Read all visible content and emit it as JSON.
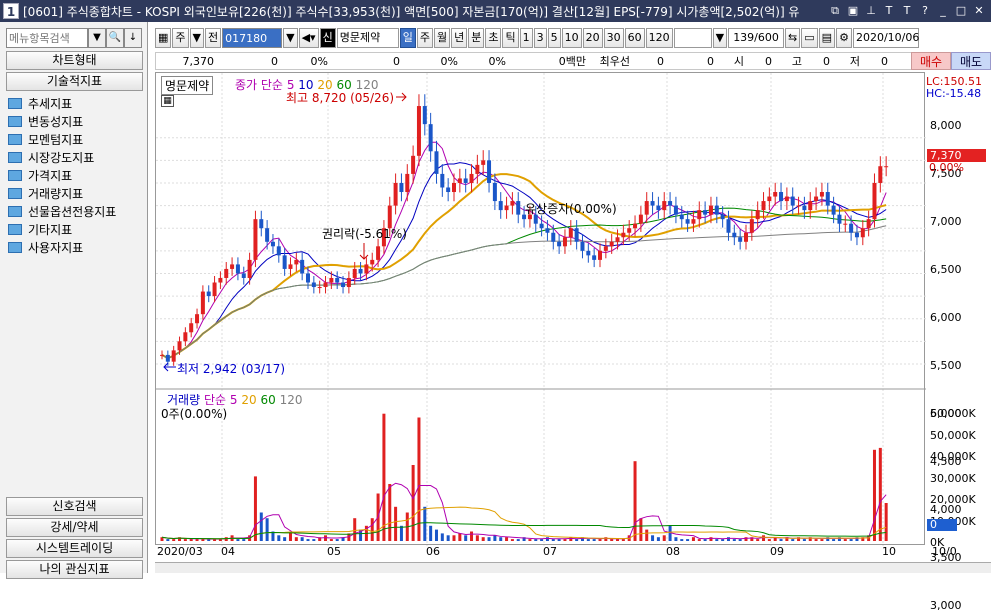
{
  "window": {
    "num": "1",
    "title": "[0601] 주식종합차트 - KOSPI 외국인보유[226(천)] 주식수[33,953(천)] 액면[500] 자본금[170(억)] 결산[12월] EPS[-779] 시가총액[2,502(억)] 유"
  },
  "left": {
    "search_placeholder": "메뉴항목검색",
    "top_buttons": [
      "차트형태",
      "기술적지표"
    ],
    "tree": [
      "추세지표",
      "변동성지표",
      "모멘텀지표",
      "시장강도지표",
      "가격지표",
      "거래량지표",
      "선물옵션전용지표",
      "기타지표",
      "사용자지표"
    ],
    "bottom_buttons": [
      "신호검색",
      "강세/약세",
      "시스템트레이딩",
      "나의 관심지표"
    ]
  },
  "toolbar": {
    "market": "주",
    "prev": "전",
    "code": "017180",
    "name": "명문제약",
    "periods": [
      "일",
      "주",
      "월",
      "년",
      "분",
      "초",
      "틱"
    ],
    "active_period": "일",
    "intervals": [
      "1",
      "3",
      "5",
      "10",
      "20",
      "30",
      "60",
      "120"
    ],
    "count": "139/600",
    "date": "2020/10/06"
  },
  "info": {
    "price": "7,370",
    "change": "0",
    "rate": "0%",
    "c2": "0",
    "r2": "0%",
    "r3": "0%",
    "vol_label": "0백만",
    "pref": "최우선",
    "p1": "0",
    "p2": "0",
    "open_l": "시",
    "open": "0",
    "high_l": "고",
    "high": "0",
    "low_l": "저",
    "low": "0",
    "buy": "매수",
    "sell": "매도"
  },
  "chart_legend": {
    "name": "명문제약",
    "ma_label": "종가 단순",
    "ma": [
      "5",
      "10",
      "20",
      "60",
      "120"
    ],
    "ma_colors": [
      "#b000b0",
      "#0000c0",
      "#e0a000",
      "#008800",
      "#808080"
    ]
  },
  "vol_legend": {
    "name": "거래량",
    "ma_label": "단순",
    "ma": [
      "5",
      "20",
      "60",
      "120"
    ],
    "unit": "0주(0.00%)"
  },
  "annotations": {
    "high": "최고 8,720 (05/26)",
    "low": "최저 2,942 (03/17)",
    "right": "권리락(-5.61%)",
    "rights_issue": "유상증자(0.00%)"
  },
  "yaxis": {
    "lc": "LC:150.51",
    "hc": "HC:-15.48",
    "ticks": [
      "8,000",
      "7,500",
      "7,000",
      "6,500",
      "6,000",
      "5,500",
      "5,000",
      "4,500",
      "4,000",
      "3,500",
      "3,000"
    ],
    "current": "7,370",
    "pct": "0.00%",
    "vol_ticks": [
      "60,000K",
      "50,000K",
      "40,000K",
      "30,000K",
      "20,000K",
      "10,000K",
      "0K"
    ],
    "vol_current": "0"
  },
  "xaxis": [
    "2020/03",
    "04",
    "05",
    "06",
    "07",
    "08",
    "09",
    "10",
    "10/0"
  ],
  "chart_data": {
    "type": "candlestick",
    "ylim": [
      2800,
      8900
    ],
    "closes": [
      3200,
      3050,
      3300,
      3500,
      3700,
      3900,
      4100,
      4600,
      4500,
      4800,
      4900,
      5100,
      5200,
      5000,
      4900,
      5300,
      6200,
      6000,
      5700,
      5600,
      5400,
      5100,
      5200,
      5300,
      5000,
      4800,
      4700,
      4700,
      4800,
      4900,
      4800,
      4700,
      4900,
      5100,
      5000,
      5200,
      5300,
      5600,
      6000,
      6500,
      7000,
      6800,
      7200,
      7600,
      8700,
      8300,
      7700,
      7200,
      6900,
      6800,
      7000,
      7100,
      7000,
      7200,
      7400,
      7500,
      7000,
      6600,
      6400,
      6500,
      6600,
      6300,
      6200,
      6300,
      6100,
      6000,
      5900,
      5700,
      5600,
      5800,
      6000,
      5700,
      5500,
      5400,
      5300,
      5500,
      5600,
      5700,
      5800,
      5900,
      6000,
      6100,
      6300,
      6600,
      6500,
      6400,
      6600,
      6500,
      6300,
      6200,
      6100,
      6200,
      6400,
      6300,
      6500,
      6300,
      6200,
      5900,
      5800,
      5700,
      5900,
      6200,
      6400,
      6600,
      6700,
      6800,
      6600,
      6700,
      6500,
      6500,
      6400,
      6600,
      6700,
      6800,
      6500,
      6300,
      6100,
      6100,
      5900,
      5800,
      6000,
      6200,
      7000,
      7370,
      7370
    ],
    "volumes": [
      2,
      1,
      1,
      2,
      1,
      1,
      1,
      1,
      1,
      1,
      1,
      2,
      3,
      1,
      1,
      3,
      34,
      15,
      12,
      5,
      3,
      2,
      5,
      2,
      2,
      1,
      1,
      2,
      3,
      1,
      1,
      2,
      4,
      12,
      6,
      8,
      12,
      25,
      67,
      30,
      18,
      8,
      15,
      40,
      65,
      18,
      8,
      6,
      4,
      3,
      3,
      4,
      3,
      5,
      3,
      2,
      2,
      3,
      2,
      2,
      1,
      1,
      2,
      1,
      1,
      1,
      2,
      1,
      1,
      1,
      2,
      1,
      2,
      1,
      1,
      1,
      2,
      1,
      1,
      1,
      3,
      42,
      12,
      6,
      3,
      2,
      3,
      8,
      2,
      1,
      1,
      2,
      1,
      1,
      2,
      1,
      1,
      2,
      1,
      1,
      2,
      2,
      1,
      3,
      1,
      2,
      1,
      2,
      1,
      2,
      1,
      2,
      1,
      1,
      2,
      1,
      2,
      1,
      1,
      2,
      2,
      3,
      48,
      49,
      20
    ]
  }
}
